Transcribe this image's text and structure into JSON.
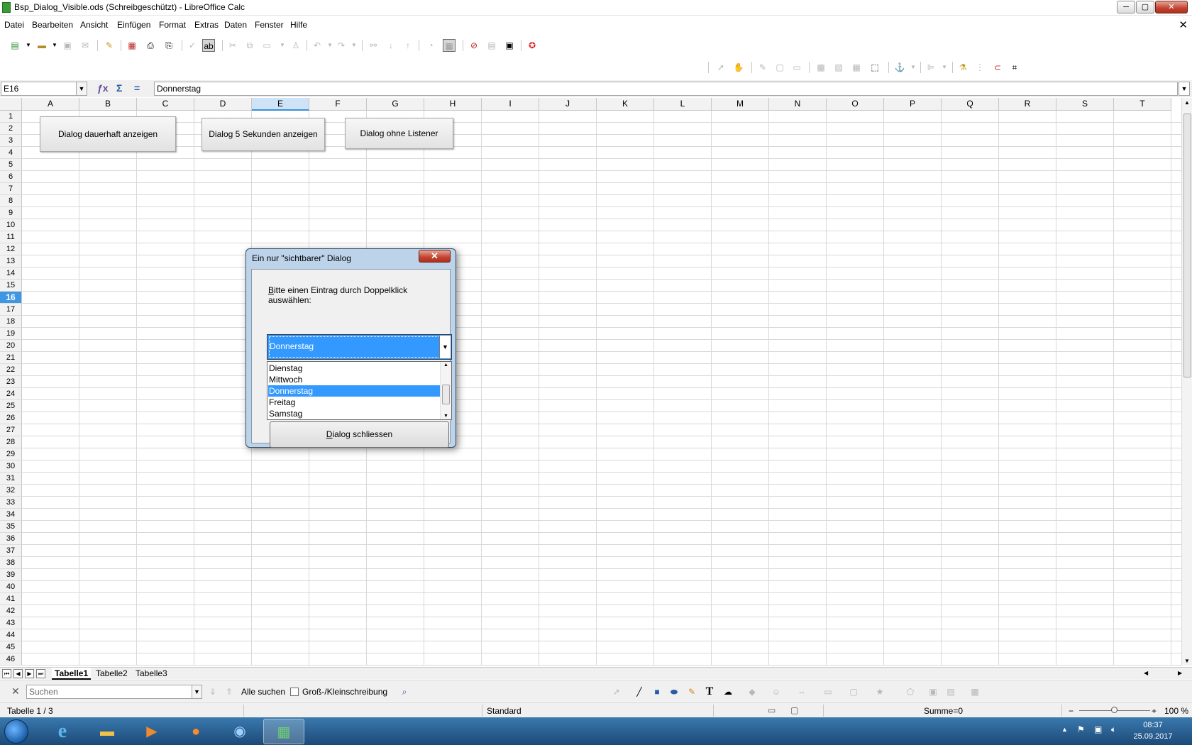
{
  "window": {
    "title": "Bsp_Dialog_Visible.ods (Schreibgeschützt) - LibreOffice Calc",
    "min": "─",
    "max": "▢",
    "close": "✕"
  },
  "menu": {
    "items": [
      "Datei",
      "Bearbeiten",
      "Ansicht",
      "Einfügen",
      "Format",
      "Extras",
      "Daten",
      "Fenster",
      "Hilfe"
    ],
    "close_doc": "✕"
  },
  "formula_bar": {
    "cell_ref": "E16",
    "value": "Donnerstag"
  },
  "columns": [
    "A",
    "B",
    "C",
    "D",
    "E",
    "F",
    "G",
    "H",
    "I",
    "J",
    "K",
    "L",
    "M",
    "N",
    "O",
    "P",
    "Q",
    "R",
    "S",
    "T"
  ],
  "selected_column": "E",
  "rows": [
    "1",
    "2",
    "3",
    "4",
    "5",
    "6",
    "7",
    "8",
    "9",
    "10",
    "11",
    "12",
    "13",
    "14",
    "15",
    "16",
    "17",
    "18",
    "19",
    "20",
    "21",
    "22",
    "23",
    "24",
    "25",
    "26",
    "27",
    "28",
    "29",
    "30",
    "31",
    "32",
    "33",
    "34",
    "35",
    "36",
    "37",
    "38",
    "39",
    "40",
    "41",
    "42",
    "43",
    "44",
    "45",
    "46"
  ],
  "selected_row": "16",
  "sheet_buttons": {
    "show_permanent": "Dialog dauerhaft anzeigen",
    "show_5sec": "Dialog 5 Sekunden anzeigen",
    "no_listener": "Dialog ohne Listener"
  },
  "sheet_tabs": [
    "Tabelle1",
    "Tabelle2",
    "Tabelle3"
  ],
  "active_sheet": "Tabelle1",
  "findbar": {
    "placeholder": "Suchen",
    "find_all": "Alle suchen",
    "match_case": "Groß-/Kleinschreibung"
  },
  "statusbar": {
    "sheet": "Tabelle 1 / 3",
    "style": "Standard",
    "sum": "Summe=0",
    "zoom": "100 %"
  },
  "taskbar": {
    "time": "08:37",
    "date": "25.09.2017"
  },
  "dialog": {
    "title": "Ein nur \"sichtbarer\" Dialog",
    "close": "✕",
    "prompt": "Bitte einen Eintrag durch Doppelklick auswählen:",
    "prompt_accel": "B",
    "prompt_rest": "itte einen Eintrag durch Doppelklick auswählen:",
    "combo_value": "Donnerstag",
    "list_items": [
      "Dienstag",
      "Mittwoch",
      "Donnerstag",
      "Freitag",
      "Samstag"
    ],
    "selected_item": "Donnerstag",
    "button_accel": "D",
    "button_rest": "ialog schliessen"
  },
  "colors": {
    "selection": "#3399ff",
    "header_selected": "#3f96e3",
    "dialog_frame": "#bcd3ea"
  }
}
